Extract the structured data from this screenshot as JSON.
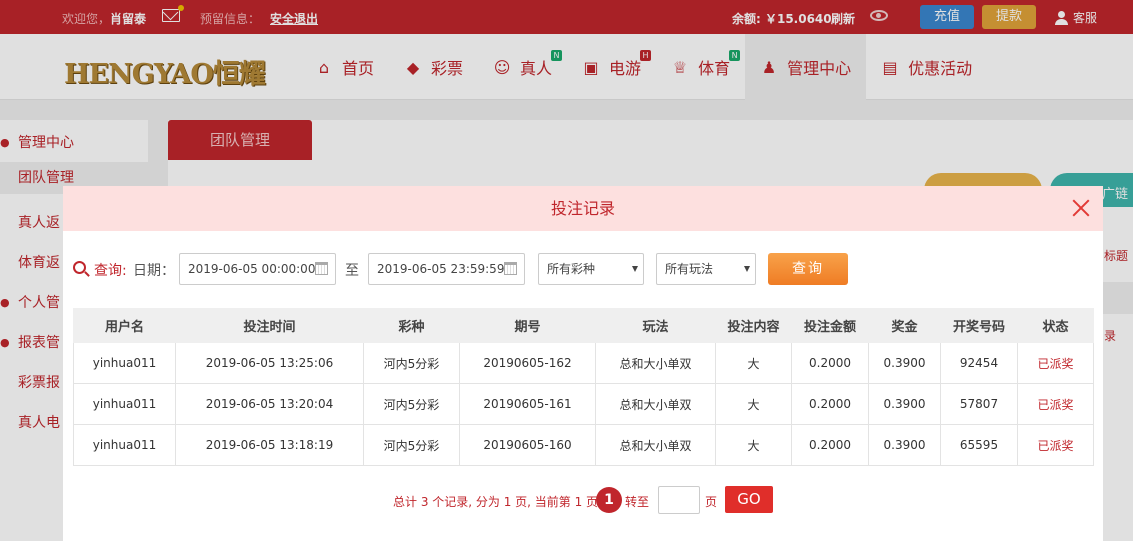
{
  "topbar": {
    "welcome": "欢迎您，",
    "username": "肖留泰",
    "notice_label": "预留信息：",
    "logout": "安全退出",
    "balance": "余额: ￥15.0640",
    "refresh": "刷新",
    "recharge": "充值",
    "withdraw": "提款",
    "service": "客服"
  },
  "logo_text": "HENGYAO恒耀",
  "nav": [
    {
      "label": "首页",
      "icon": "home-icon",
      "glyph": "⌂",
      "badge": ""
    },
    {
      "label": "彩票",
      "icon": "lottery-icon",
      "glyph": "◆",
      "badge": ""
    },
    {
      "label": "真人",
      "icon": "dealer-icon",
      "glyph": "☺",
      "badge": "N"
    },
    {
      "label": "电游",
      "icon": "slot-machine-icon",
      "glyph": "▣",
      "badge": "H"
    },
    {
      "label": "体育",
      "icon": "trophy-icon",
      "glyph": "♕",
      "badge": "N"
    },
    {
      "label": "管理中心",
      "icon": "users-icon",
      "glyph": "♟",
      "badge": ""
    },
    {
      "label": "优惠活动",
      "icon": "gift-icon",
      "glyph": "▤",
      "badge": ""
    }
  ],
  "sidebar": {
    "items": [
      "管理中心",
      "团队管理",
      "真人返",
      "体育返",
      "个人管",
      "报表管",
      "彩票报",
      "真人电"
    ]
  },
  "background": {
    "tab": "团队管理",
    "frag_link": "广链",
    "frag_title": "标题",
    "frag_record": "录"
  },
  "modal": {
    "title": "投注记录",
    "filter": {
      "query_label": "查询:",
      "date_label": "日期：",
      "start": "2019-06-05 00:00:00",
      "to": "至",
      "end": "2019-06-05 23:59:59",
      "lottery": "所有彩种",
      "play": "所有玩法",
      "query_button": "查询"
    },
    "table": {
      "headers": [
        "用户名",
        "投注时间",
        "彩种",
        "期号",
        "玩法",
        "投注内容",
        "投注金额",
        "奖金",
        "开奖号码",
        "状态"
      ],
      "rows": [
        [
          "yinhua011",
          "2019-06-05 13:25:06",
          "河内5分彩",
          "20190605-162",
          "总和大小单双",
          "大",
          "0.2000",
          "0.3900",
          "92454",
          "已派奖"
        ],
        [
          "yinhua011",
          "2019-06-05 13:20:04",
          "河内5分彩",
          "20190605-161",
          "总和大小单双",
          "大",
          "0.2000",
          "0.3900",
          "57807",
          "已派奖"
        ],
        [
          "yinhua011",
          "2019-06-05 13:18:19",
          "河内5分彩",
          "20190605-160",
          "总和大小单双",
          "大",
          "0.2000",
          "0.3900",
          "65595",
          "已派奖"
        ]
      ]
    },
    "pager": {
      "summary": "总计 3 个记录, 分为 1 页, 当前第 1 页",
      "current": "1",
      "goto": "转至",
      "page_unit": "页",
      "go": "GO"
    }
  },
  "colors": {
    "brand": "#c0262c",
    "accent": "#ef7c24",
    "modal_header": "#fde0df"
  }
}
